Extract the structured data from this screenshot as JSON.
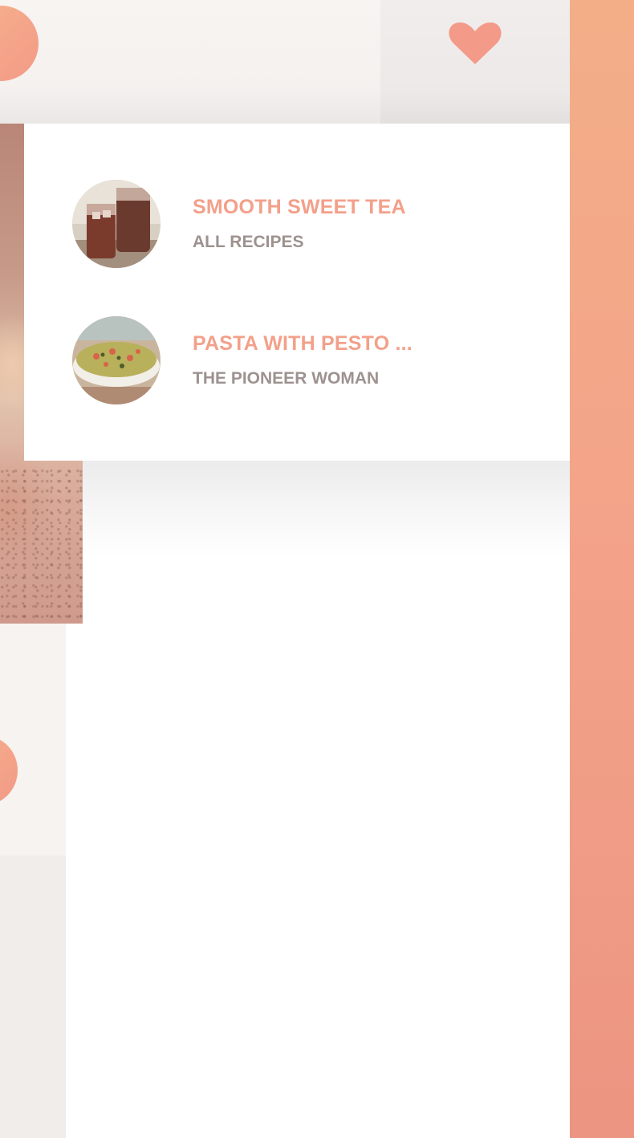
{
  "favorites_popup": {
    "items": [
      {
        "title": "SMOOTH SWEET TEA",
        "source": "ALL RECIPES",
        "image": "iced-tea-photo"
      },
      {
        "title": "PASTA WITH PESTO ...",
        "source": "THE PIONEER WOMAN",
        "image": "pesto-pasta-photo"
      }
    ]
  },
  "header": {
    "favorite_icon": "heart-icon"
  },
  "colors": {
    "accent": "#f3a08a",
    "source_text": "#9d928f",
    "rail_gradient_start": "#f3ae88",
    "rail_gradient_end": "#ec9582"
  }
}
